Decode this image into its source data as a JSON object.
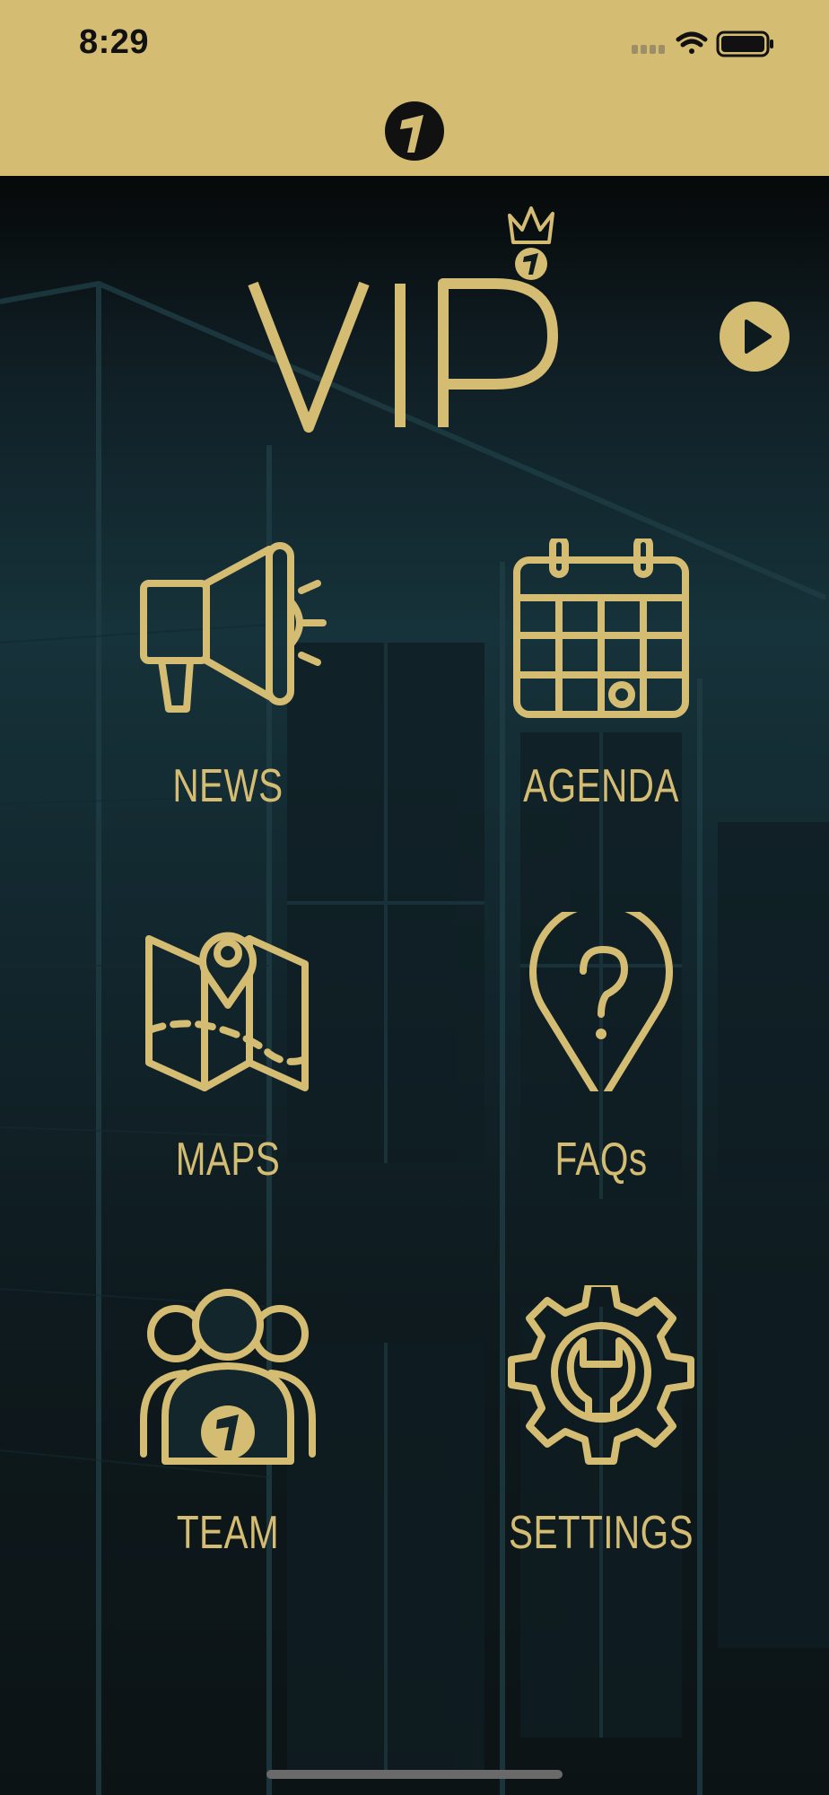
{
  "status_bar": {
    "time": "8:29",
    "icons": [
      "signal-icon",
      "wifi-icon",
      "battery-icon"
    ]
  },
  "header": {
    "logo_icon": "brand-one-icon",
    "background_color": "#d5bc73"
  },
  "hero": {
    "logo_text": "VIP",
    "logo_icon": "crown-icon",
    "play_icon": "play-icon"
  },
  "menu": [
    {
      "label": "NEWS",
      "icon": "megaphone-icon"
    },
    {
      "label": "AGENDA",
      "icon": "calendar-icon"
    },
    {
      "label": "MAPS",
      "icon": "map-icon"
    },
    {
      "label": "FAQs",
      "icon": "question-pin-icon"
    },
    {
      "label": "TEAM",
      "icon": "team-icon"
    },
    {
      "label": "SETTINGS",
      "icon": "gear-icon"
    }
  ],
  "theme": {
    "accent": "#d5bc73",
    "background": "#12262d"
  }
}
